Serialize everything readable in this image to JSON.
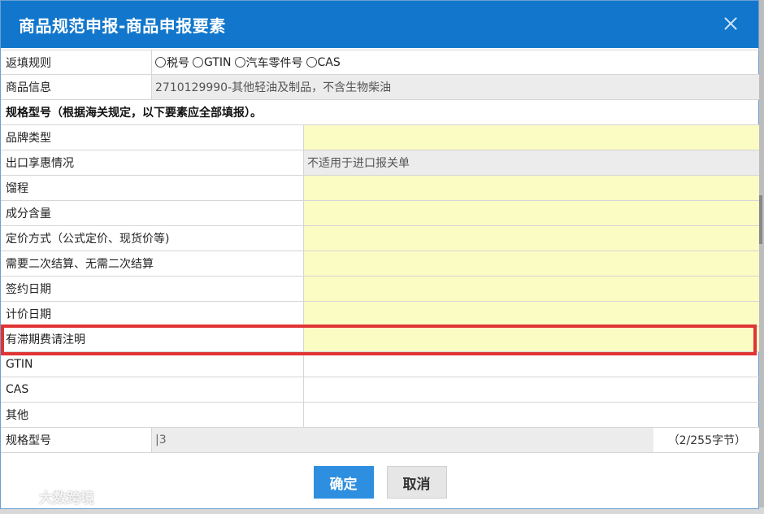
{
  "dialog": {
    "title": "商品规范申报-商品申报要素"
  },
  "top_rows": [
    {
      "label": "返填规则"
    },
    {
      "label": "商品信息",
      "value": "2710129990-其他轻油及制品，不含生物柴油"
    }
  ],
  "radio_options": [
    "税号",
    "GTIN",
    "汽车零件号",
    "CAS"
  ],
  "section_title": "规格型号（根据海关规定，以下要素应全部填报）。",
  "spec_rows": [
    {
      "label": "品牌类型",
      "value": ""
    },
    {
      "label": "出口享惠情况",
      "value": "不适用于进口报关单"
    },
    {
      "label": "馏程",
      "value": ""
    },
    {
      "label": "成分含量",
      "value": ""
    },
    {
      "label": "定价方式（公式定价、现货价等)",
      "value": ""
    },
    {
      "label": "需要二次结算、无需二次结算",
      "value": ""
    },
    {
      "label": "签约日期",
      "value": ""
    },
    {
      "label": "计价日期",
      "value": ""
    },
    {
      "label": "有滞期费请注明",
      "value": ""
    },
    {
      "label": "GTIN",
      "value": ""
    },
    {
      "label": "CAS",
      "value": ""
    },
    {
      "label": "其他",
      "value": ""
    }
  ],
  "spec_model": {
    "label": "规格型号",
    "value": "|3",
    "counter": "（2/255字节）"
  },
  "buttons": {
    "ok": "确定",
    "cancel": "取消"
  },
  "watermark": "大数跨境",
  "colors": {
    "titlebar": "#1277cc",
    "required_field": "#fbfbc4",
    "readonly_field": "#ececec",
    "highlight": "#e03434",
    "ok_button": "#2e8ee0"
  }
}
